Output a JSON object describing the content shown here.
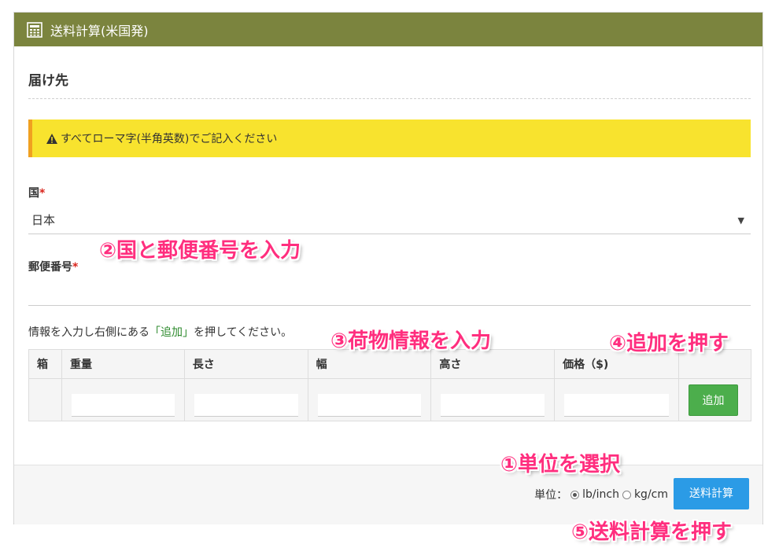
{
  "panel": {
    "title": "送料計算(米国発)"
  },
  "destination": {
    "section_title": "届け先"
  },
  "alert": {
    "text": "すべてローマ字(半角英数)でご記入ください"
  },
  "country": {
    "label": "国",
    "required_mark": "*",
    "selected": "日本"
  },
  "postal": {
    "label": "郵便番号",
    "required_mark": "*",
    "value": ""
  },
  "instruction": {
    "prefix": "情報を入力し右側にある",
    "link": "「追加」",
    "suffix": "を押してください。"
  },
  "table": {
    "headers": [
      "箱",
      "重量",
      "長さ",
      "幅",
      "高さ",
      "価格（$)",
      ""
    ],
    "add_button": "追加"
  },
  "footer": {
    "unit_label": "単位：",
    "options": [
      {
        "label": "lb/inch",
        "selected": true
      },
      {
        "label": "kg/cm",
        "selected": false
      }
    ],
    "calc_button": "送料計算"
  },
  "annotations": {
    "step1": "①単位を選択",
    "step2": "②国と郵便番号を入力",
    "step3": "③荷物情報を入力",
    "step4": "④追加を押す",
    "step5": "⑤送料計算を押す"
  },
  "colors": {
    "header": "#7b843e",
    "alert": "#f8e32e",
    "add": "#4cae4c",
    "calc": "#2b9be6",
    "annotation": "#ff2e7e"
  },
  "icons": {
    "header": "calculator-icon",
    "alert": "warning-icon",
    "select": "caret-down-icon"
  }
}
